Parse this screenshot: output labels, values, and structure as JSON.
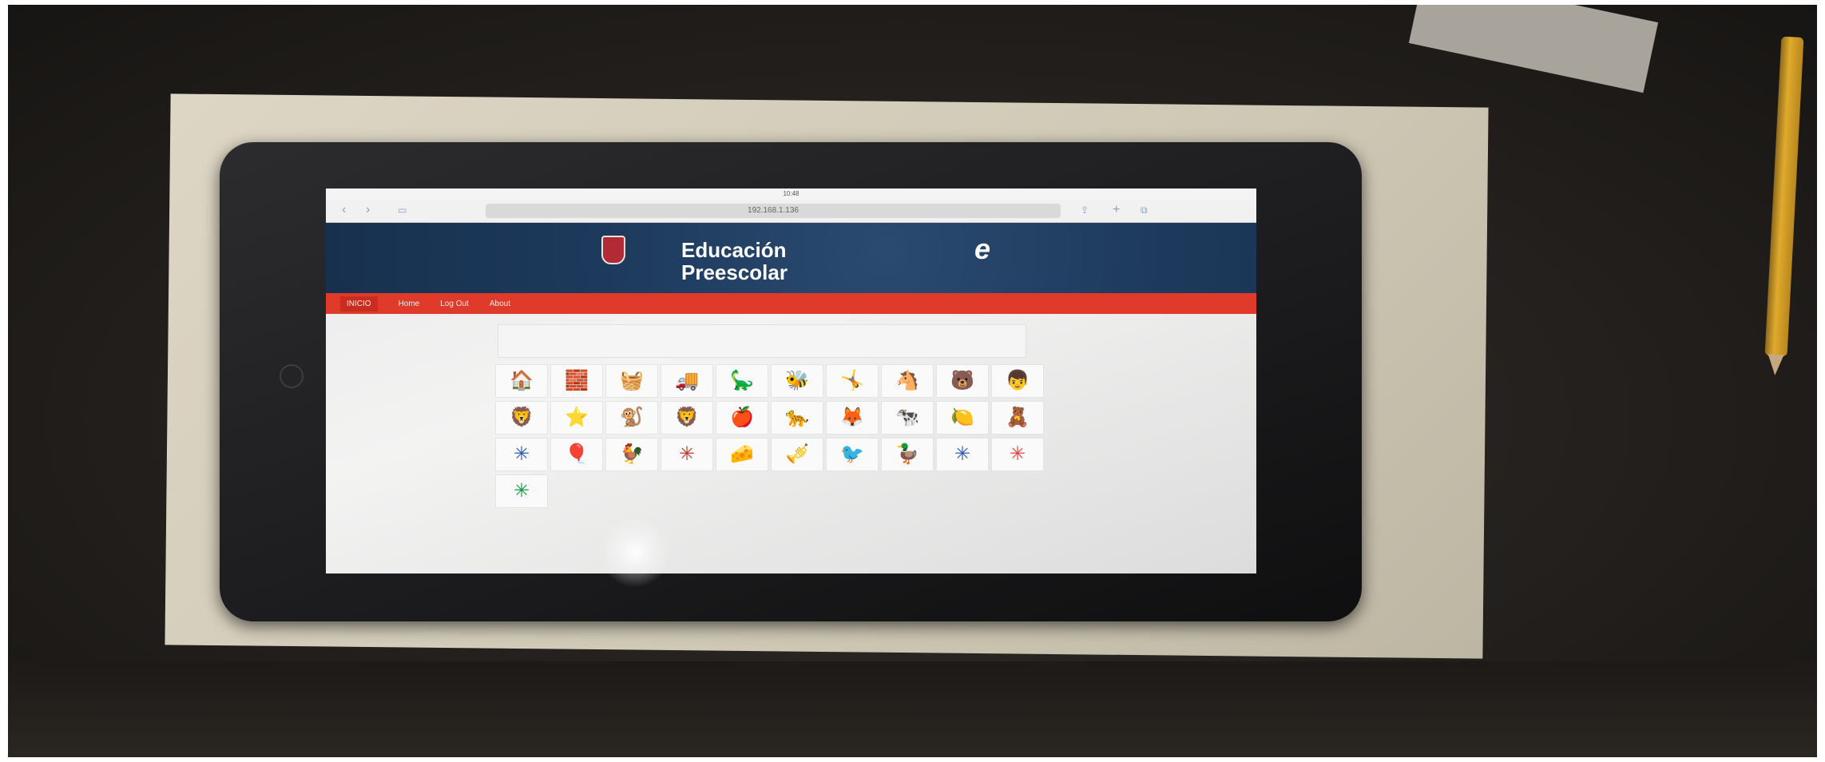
{
  "browser": {
    "status_time": "10:48",
    "url": "192.168.1.136",
    "back_icon": "chevron-left-icon",
    "forward_icon": "chevron-right-icon"
  },
  "site": {
    "title_line1": "Educación",
    "title_line2": "Preescolar",
    "logo_letter": "e"
  },
  "nav": {
    "items": [
      {
        "label": "INICIO",
        "active": true
      },
      {
        "label": "Home"
      },
      {
        "label": "Log Out"
      },
      {
        "label": "About"
      }
    ]
  },
  "tiles": [
    "🏠",
    "🧱",
    "🧺",
    "🚚",
    "🦕",
    "🐝",
    "🤸",
    "🐴",
    "🐻",
    "👦",
    "🦁",
    "⭐",
    "🐒",
    "🦁",
    "🍎",
    "🐆",
    "🦊",
    "🐄",
    "🍋",
    "🧸",
    "✳",
    "🎈",
    "🐓",
    "✳",
    "🧀",
    "🎺",
    "🐦",
    "🦆",
    "✳",
    "✳",
    "✳"
  ],
  "tile_colors": [
    "#2e5db5",
    "#e04545",
    "#1c9a42",
    "#c0392b"
  ]
}
